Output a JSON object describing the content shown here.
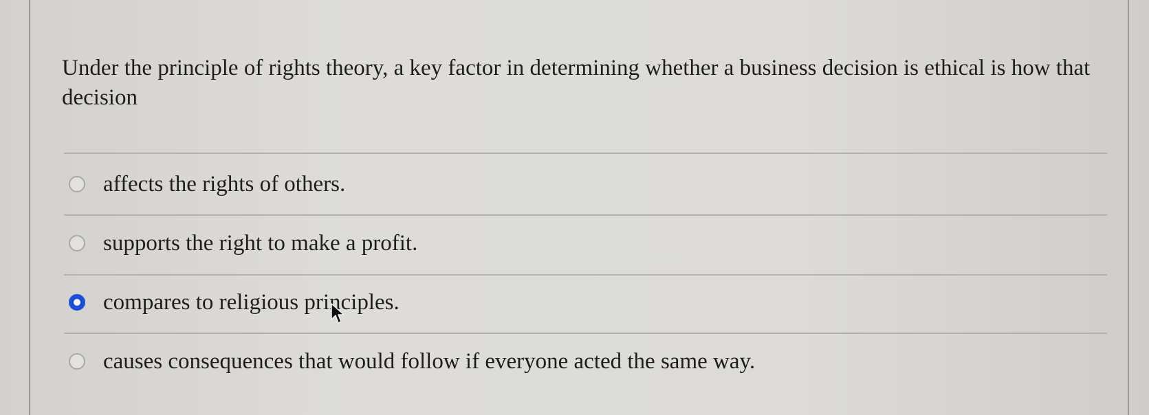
{
  "question": {
    "text": "Under the principle of rights theory, a key factor in determining whether a business decision is ethical is how that decision"
  },
  "options": [
    {
      "label": "affects the rights of others.",
      "selected": false
    },
    {
      "label": "supports the right to make a profit.",
      "selected": false
    },
    {
      "label": "compares to religious principles.",
      "selected": true
    },
    {
      "label": "causes consequences that would follow if everyone acted the same way.",
      "selected": false
    }
  ],
  "colors": {
    "selected_radio": "#1c4fd4",
    "text": "#1f1e1d",
    "divider": "#b3b2ae"
  },
  "icons": {
    "cursor": "mouse-pointer-icon"
  }
}
